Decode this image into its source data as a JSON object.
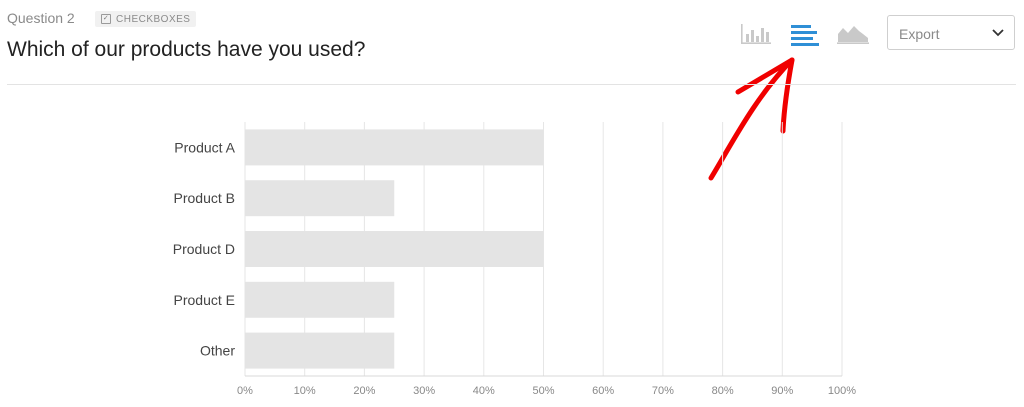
{
  "question": {
    "number_label": "Question 2",
    "type_badge": "CHECKBOXES",
    "title": "Which of our products have you used?"
  },
  "toolbar": {
    "views": [
      {
        "name": "vertical-bar-chart-icon",
        "active": false
      },
      {
        "name": "horizontal-bar-chart-icon",
        "active": true
      },
      {
        "name": "area-chart-icon",
        "active": false
      }
    ],
    "export_label": "Export"
  },
  "colors": {
    "bar": "#e4e4e4",
    "grid": "#e6e6e6",
    "active_icon": "#2f8fd6",
    "inactive_icon": "#c9c9c9",
    "annotation_arrow": "#f00000"
  },
  "chart_data": {
    "type": "bar",
    "orientation": "horizontal",
    "categories": [
      "Product A",
      "Product B",
      "Product D",
      "Product E",
      "Other"
    ],
    "values": [
      50,
      25,
      50,
      25,
      25
    ],
    "xlim": [
      0,
      100
    ],
    "x_ticks": [
      "0%",
      "10%",
      "20%",
      "30%",
      "40%",
      "50%",
      "60%",
      "70%",
      "80%",
      "90%",
      "100%"
    ],
    "grid": true
  }
}
